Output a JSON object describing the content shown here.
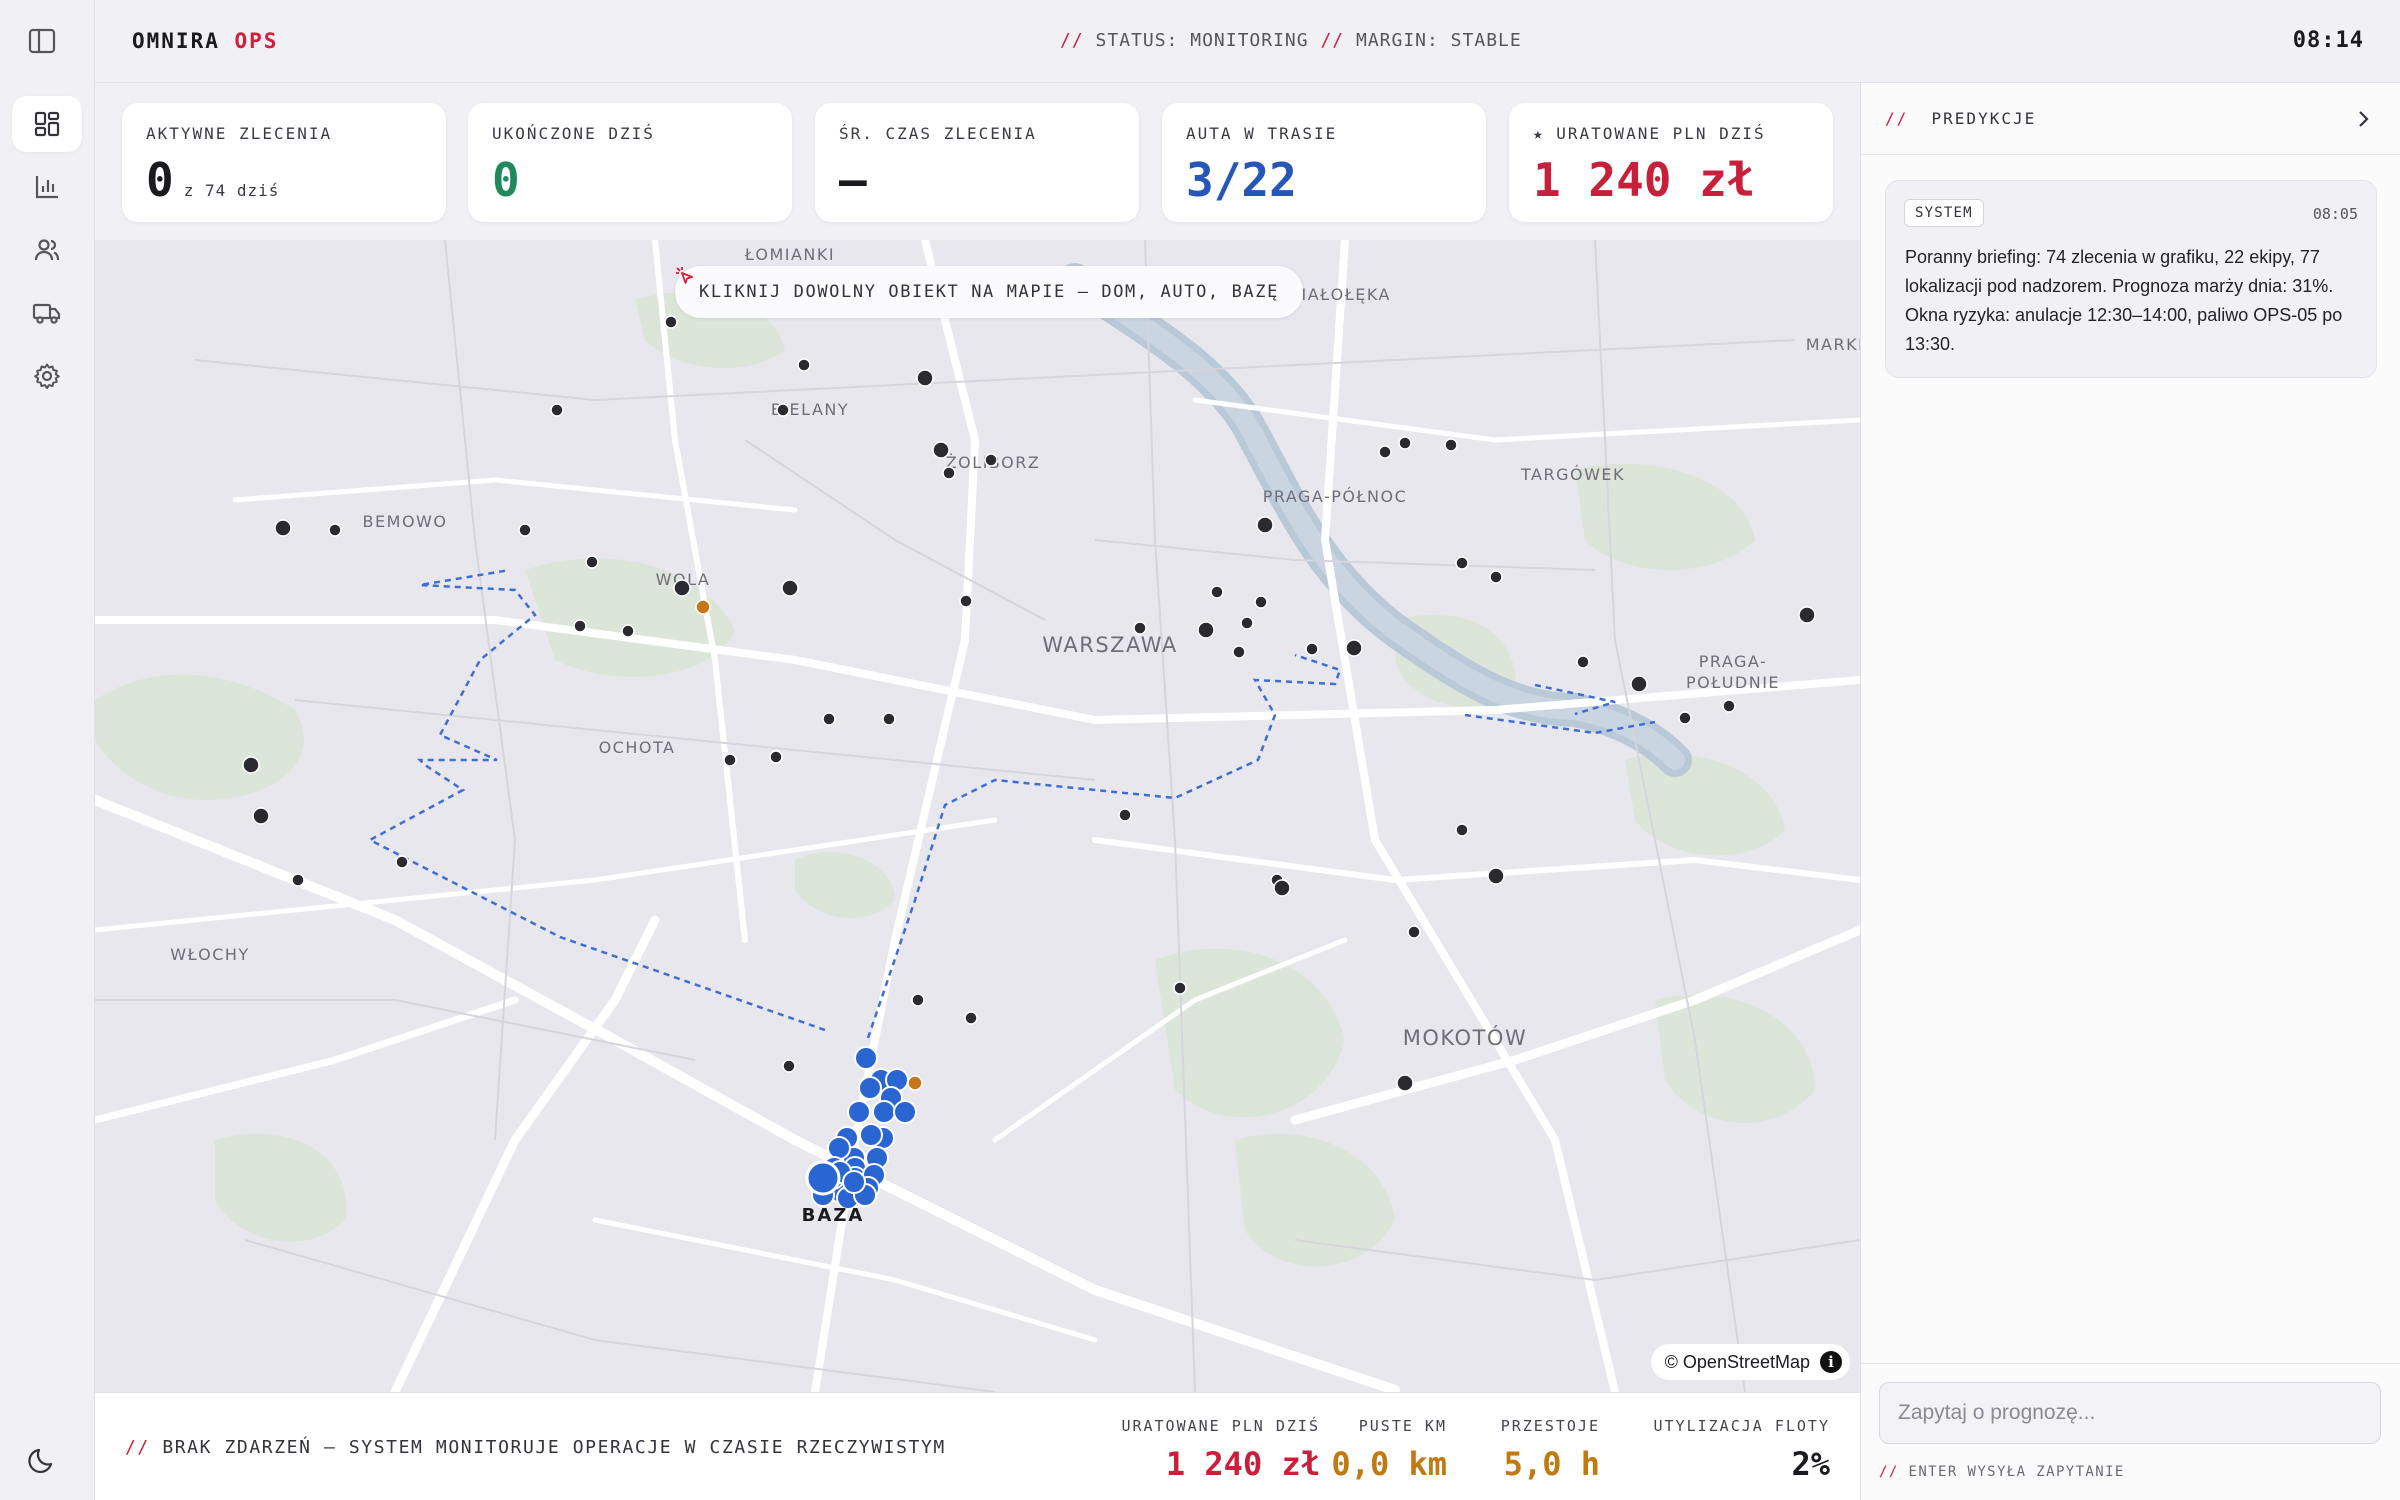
{
  "brand": {
    "name": "OMNIRA",
    "suffix": "OPS"
  },
  "header": {
    "status_prefix": "//",
    "status": "STATUS: MONITORING",
    "margin_sep": "//",
    "margin": "MARGIN: STABLE",
    "clock": "08:14"
  },
  "sidebar": {
    "items": [
      {
        "name": "dashboard",
        "icon": "dashboard-icon",
        "active": true
      },
      {
        "name": "analytics",
        "icon": "bar-chart-icon",
        "active": false
      },
      {
        "name": "team",
        "icon": "users-icon",
        "active": false
      },
      {
        "name": "fleet",
        "icon": "truck-icon",
        "active": false
      },
      {
        "name": "settings",
        "icon": "gear-icon",
        "active": false
      }
    ],
    "theme_icon": "moon-icon"
  },
  "kpis": [
    {
      "label": "AKTYWNE ZLECENIA",
      "value": "0",
      "sub": "z 74 dziś",
      "color": "#111111"
    },
    {
      "label": "UKOŃCZONE DZIŚ",
      "value": "0",
      "sub": "",
      "color": "#1f8a5b"
    },
    {
      "label": "ŚR. CZAS ZLECENIA",
      "value": "—",
      "sub": "",
      "color": "#111111"
    },
    {
      "label": "AUTA W TRASIE",
      "value": "3/22",
      "sub": "",
      "color": "#2656b8"
    },
    {
      "label": "★ URATOWANE PLN DZIŚ",
      "value": "1 240 zł",
      "sub": "",
      "color": "#c8203b"
    }
  ],
  "map": {
    "hint": "KLIKNIJ DOWOLNY OBIEKT NA MAPIE — DOM, AUTO, BAZĘ",
    "base_label": "BAZA",
    "attribution": "© OpenStreetMap",
    "districts": [
      {
        "name": "ŁOMIANKI",
        "size": "small"
      },
      {
        "name": "BIAŁOŁĘKA",
        "size": "small"
      },
      {
        "name": "MARKI",
        "size": "small"
      },
      {
        "name": "BIELANY",
        "size": "small"
      },
      {
        "name": "ŻOLIBORZ",
        "size": "small"
      },
      {
        "name": "TARGÓWEK",
        "size": "small"
      },
      {
        "name": "PRAGA-PÓŁNOC",
        "size": "small"
      },
      {
        "name": "BEMOWO",
        "size": "small"
      },
      {
        "name": "WOLA",
        "size": "small"
      },
      {
        "name": "WARSZAWA",
        "size": "large"
      },
      {
        "name": "PRAGA-",
        "size": "small"
      },
      {
        "name": "POŁUDNIE",
        "size": "small"
      },
      {
        "name": "OCHOTA",
        "size": "small"
      },
      {
        "name": "WŁOCHY",
        "size": "small"
      },
      {
        "name": "MOKOTÓW",
        "size": "large"
      }
    ],
    "colors": {
      "vehicle": "#2a66d2",
      "alert": "#c7761a",
      "house": "#2a2a30",
      "route": "#3c6fd0"
    }
  },
  "bottom": {
    "events_prefix": "//",
    "events": "BRAK ZDARZEŃ — SYSTEM MONITORUJE OPERACJE W CZASIE RZECZYWISTYM",
    "metrics": [
      {
        "label": "URATOWANE PLN DZIŚ",
        "value": "1 240 zł",
        "color": "#c8203b"
      },
      {
        "label": "PUSTE KM",
        "value": "0,0 km",
        "color": "#c07a10"
      },
      {
        "label": "PRZESTOJE",
        "value": "5,0 h",
        "color": "#c07a10"
      },
      {
        "label": "UTYLIZACJA FLOTY",
        "value": "2%",
        "color": "#111111"
      }
    ]
  },
  "panel": {
    "title_prefix": "//",
    "title": "PREDYKCJE",
    "message": {
      "badge": "SYSTEM",
      "time": "08:05",
      "text": "Poranny briefing: 74 zlecenia w grafiku, 22 ekipy, 77 lokalizacji pod nadzorem. Prognoza marży dnia: 31%. Okna ryzyka: anulacje 12:30–14:00, paliwo OPS-05 po 13:30."
    },
    "input_placeholder": "Zapytaj o prognozę...",
    "enter_prefix": "//",
    "enter_hint": "ENTER WYSYŁA ZAPYTANIE"
  }
}
